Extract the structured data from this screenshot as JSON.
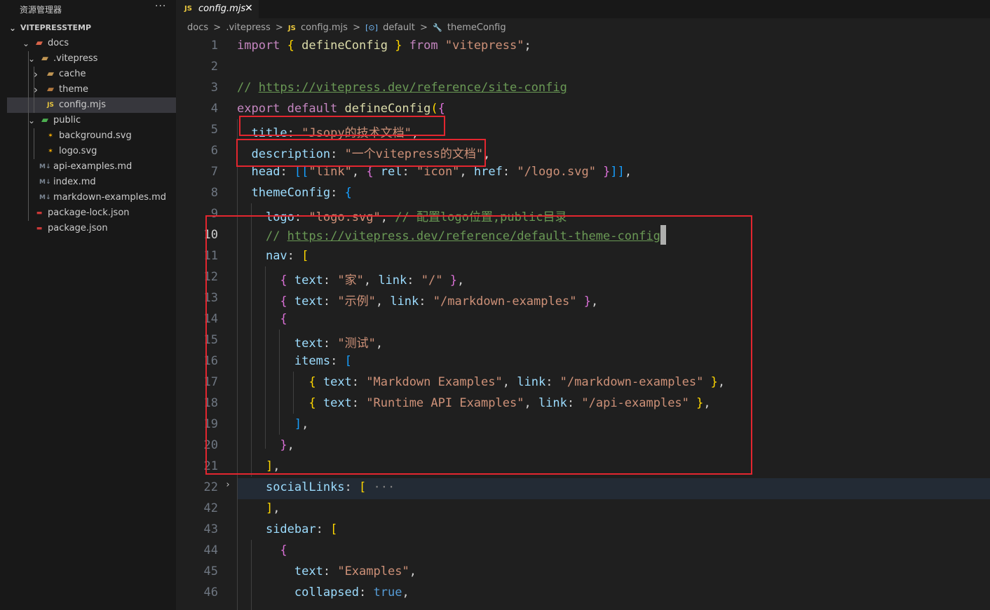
{
  "sidebar": {
    "title": "资源管理器",
    "more": "···",
    "root": "VITEPRESSTEMP",
    "tree": [
      {
        "label": "docs",
        "depth": 1,
        "chevron": "down",
        "icon": "folder-docs-icon"
      },
      {
        "label": ".vitepress",
        "depth": 2,
        "chevron": "down",
        "icon": "folder-icon"
      },
      {
        "label": "cache",
        "depth": 3,
        "chevron": "right",
        "icon": "folder-icon"
      },
      {
        "label": "theme",
        "depth": 3,
        "chevron": "right",
        "icon": "folder-theme-icon"
      },
      {
        "label": "config.mjs",
        "depth": 3,
        "chevron": "",
        "icon": "js-file-icon",
        "selected": true
      },
      {
        "label": "public",
        "depth": 2,
        "chevron": "down",
        "icon": "folder-public-icon"
      },
      {
        "label": "background.svg",
        "depth": 3,
        "chevron": "",
        "icon": "svg-file-icon"
      },
      {
        "label": "logo.svg",
        "depth": 3,
        "chevron": "",
        "icon": "svg-file-icon"
      },
      {
        "label": "api-examples.md",
        "depth": 2,
        "chevron": "",
        "icon": "markdown-file-icon"
      },
      {
        "label": "index.md",
        "depth": 2,
        "chevron": "",
        "icon": "markdown-file-icon"
      },
      {
        "label": "markdown-examples.md",
        "depth": 2,
        "chevron": "",
        "icon": "markdown-file-icon"
      },
      {
        "label": "package-lock.json",
        "depth": 1,
        "chevron": "",
        "icon": "npm-file-icon"
      },
      {
        "label": "package.json",
        "depth": 1,
        "chevron": "",
        "icon": "npm-file-icon"
      }
    ]
  },
  "tab": {
    "icon_text": "JS",
    "name": "config.mjs",
    "close": "✕"
  },
  "breadcrumb": {
    "parts": [
      "docs",
      ".vitepress",
      "config.mjs",
      "default",
      "themeConfig"
    ],
    "sep": ">",
    "js_badge": "JS",
    "default_symbol": "[⊙]",
    "theme_symbol": "🔧"
  },
  "code": {
    "line_numbers": [
      "1",
      "2",
      "3",
      "4",
      "5",
      "6",
      "7",
      "8",
      "9",
      "10",
      "11",
      "12",
      "13",
      "14",
      "15",
      "16",
      "17",
      "18",
      "19",
      "20",
      "21",
      "22",
      "42",
      "43",
      "44",
      "45",
      "46"
    ],
    "active_line": "10",
    "folded_line": "22",
    "fold_glyph": "›",
    "lines": [
      [
        [
          "k",
          "import "
        ],
        [
          "b1",
          "{ "
        ],
        [
          "f",
          "defineConfig"
        ],
        [
          "b1",
          " } "
        ],
        [
          "k",
          "from "
        ],
        [
          "s",
          "\"vitepress\""
        ],
        [
          "p",
          ";"
        ]
      ],
      [],
      [
        [
          "c",
          "// "
        ],
        [
          "cu",
          "https://vitepress.dev/reference/site-config"
        ]
      ],
      [
        [
          "k",
          "export default "
        ],
        [
          "f",
          "defineConfig"
        ],
        [
          "b1",
          "("
        ],
        [
          "b2",
          "{"
        ]
      ],
      [
        [
          "p",
          "  "
        ],
        [
          "v",
          "title"
        ],
        [
          "p",
          ": "
        ],
        [
          "s",
          "\"Jsopy的技术文档\""
        ],
        [
          "p",
          ","
        ]
      ],
      [
        [
          "p",
          "  "
        ],
        [
          "v",
          "description"
        ],
        [
          "p",
          ": "
        ],
        [
          "s",
          "\"一个vitepress的文档\""
        ],
        [
          "p",
          ","
        ]
      ],
      [
        [
          "p",
          "  "
        ],
        [
          "v",
          "head"
        ],
        [
          "p",
          ": "
        ],
        [
          "b3",
          "[["
        ],
        [
          "s",
          "\"link\""
        ],
        [
          "p",
          ", "
        ],
        [
          "b2",
          "{ "
        ],
        [
          "v",
          "rel"
        ],
        [
          "p",
          ": "
        ],
        [
          "s",
          "\"icon\""
        ],
        [
          "p",
          ", "
        ],
        [
          "v",
          "href"
        ],
        [
          "p",
          ": "
        ],
        [
          "s",
          "\"/logo.svg\""
        ],
        [
          "b2",
          " }"
        ],
        [
          "b3",
          "]]"
        ],
        [
          "p",
          ","
        ]
      ],
      [
        [
          "p",
          "  "
        ],
        [
          "v",
          "themeConfig"
        ],
        [
          "p",
          ": "
        ],
        [
          "b3",
          "{"
        ]
      ],
      [
        [
          "p",
          "    "
        ],
        [
          "v",
          "logo"
        ],
        [
          "p",
          ": "
        ],
        [
          "s",
          "\"logo.svg\""
        ],
        [
          "p",
          ", "
        ],
        [
          "c",
          "// 配置logo位置,public目录"
        ]
      ],
      [
        [
          "p",
          "    "
        ],
        [
          "c",
          "// "
        ],
        [
          "cu",
          "https://vitepress.dev/reference/default-theme-config"
        ],
        [
          "cursor",
          ""
        ]
      ],
      [
        [
          "p",
          "    "
        ],
        [
          "v",
          "nav"
        ],
        [
          "p",
          ": "
        ],
        [
          "b1",
          "["
        ]
      ],
      [
        [
          "p",
          "      "
        ],
        [
          "b2",
          "{ "
        ],
        [
          "v",
          "text"
        ],
        [
          "p",
          ": "
        ],
        [
          "s",
          "\"家\""
        ],
        [
          "p",
          ", "
        ],
        [
          "v",
          "link"
        ],
        [
          "p",
          ": "
        ],
        [
          "s",
          "\"/\""
        ],
        [
          "b2",
          " }"
        ],
        [
          "p",
          ","
        ]
      ],
      [
        [
          "p",
          "      "
        ],
        [
          "b2",
          "{ "
        ],
        [
          "v",
          "text"
        ],
        [
          "p",
          ": "
        ],
        [
          "s",
          "\"示例\""
        ],
        [
          "p",
          ", "
        ],
        [
          "v",
          "link"
        ],
        [
          "p",
          ": "
        ],
        [
          "s",
          "\"/markdown-examples\""
        ],
        [
          "b2",
          " }"
        ],
        [
          "p",
          ","
        ]
      ],
      [
        [
          "p",
          "      "
        ],
        [
          "b2",
          "{"
        ]
      ],
      [
        [
          "p",
          "        "
        ],
        [
          "v",
          "text"
        ],
        [
          "p",
          ": "
        ],
        [
          "s",
          "\"测试\""
        ],
        [
          "p",
          ","
        ]
      ],
      [
        [
          "p",
          "        "
        ],
        [
          "v",
          "items"
        ],
        [
          "p",
          ": "
        ],
        [
          "b3",
          "["
        ]
      ],
      [
        [
          "p",
          "          "
        ],
        [
          "b1",
          "{ "
        ],
        [
          "v",
          "text"
        ],
        [
          "p",
          ": "
        ],
        [
          "s",
          "\"Markdown Examples\""
        ],
        [
          "p",
          ", "
        ],
        [
          "v",
          "link"
        ],
        [
          "p",
          ": "
        ],
        [
          "s",
          "\"/markdown-examples\""
        ],
        [
          "b1",
          " }"
        ],
        [
          "p",
          ","
        ]
      ],
      [
        [
          "p",
          "          "
        ],
        [
          "b1",
          "{ "
        ],
        [
          "v",
          "text"
        ],
        [
          "p",
          ": "
        ],
        [
          "s",
          "\"Runtime API Examples\""
        ],
        [
          "p",
          ", "
        ],
        [
          "v",
          "link"
        ],
        [
          "p",
          ": "
        ],
        [
          "s",
          "\"/api-examples\""
        ],
        [
          "b1",
          " }"
        ],
        [
          "p",
          ","
        ]
      ],
      [
        [
          "p",
          "        "
        ],
        [
          "b3",
          "]"
        ],
        [
          "p",
          ","
        ]
      ],
      [
        [
          "p",
          "      "
        ],
        [
          "b2",
          "}"
        ],
        [
          "p",
          ","
        ]
      ],
      [
        [
          "p",
          "    "
        ],
        [
          "b1",
          "]"
        ],
        [
          "p",
          ","
        ]
      ],
      [
        [
          "p",
          "    "
        ],
        [
          "v",
          "socialLinks"
        ],
        [
          "p",
          ": "
        ],
        [
          "b1",
          "["
        ],
        [
          "ellip",
          " ···"
        ]
      ],
      [
        [
          "p",
          "    "
        ],
        [
          "b1",
          "]"
        ],
        [
          "p",
          ","
        ]
      ],
      [
        [
          "p",
          "    "
        ],
        [
          "v",
          "sidebar"
        ],
        [
          "p",
          ": "
        ],
        [
          "b1",
          "["
        ]
      ],
      [
        [
          "p",
          "      "
        ],
        [
          "b2",
          "{"
        ]
      ],
      [
        [
          "p",
          "        "
        ],
        [
          "v",
          "text"
        ],
        [
          "p",
          ": "
        ],
        [
          "s",
          "\"Examples\""
        ],
        [
          "p",
          ","
        ]
      ],
      [
        [
          "p",
          "        "
        ],
        [
          "v",
          "collapsed"
        ],
        [
          "p",
          ": "
        ],
        [
          "kb",
          "true"
        ],
        [
          "p",
          ","
        ]
      ]
    ]
  },
  "colors": {
    "annotation_box": "#e3262f",
    "editor_bg": "#1f1f1f",
    "sidebar_bg": "#181818"
  }
}
